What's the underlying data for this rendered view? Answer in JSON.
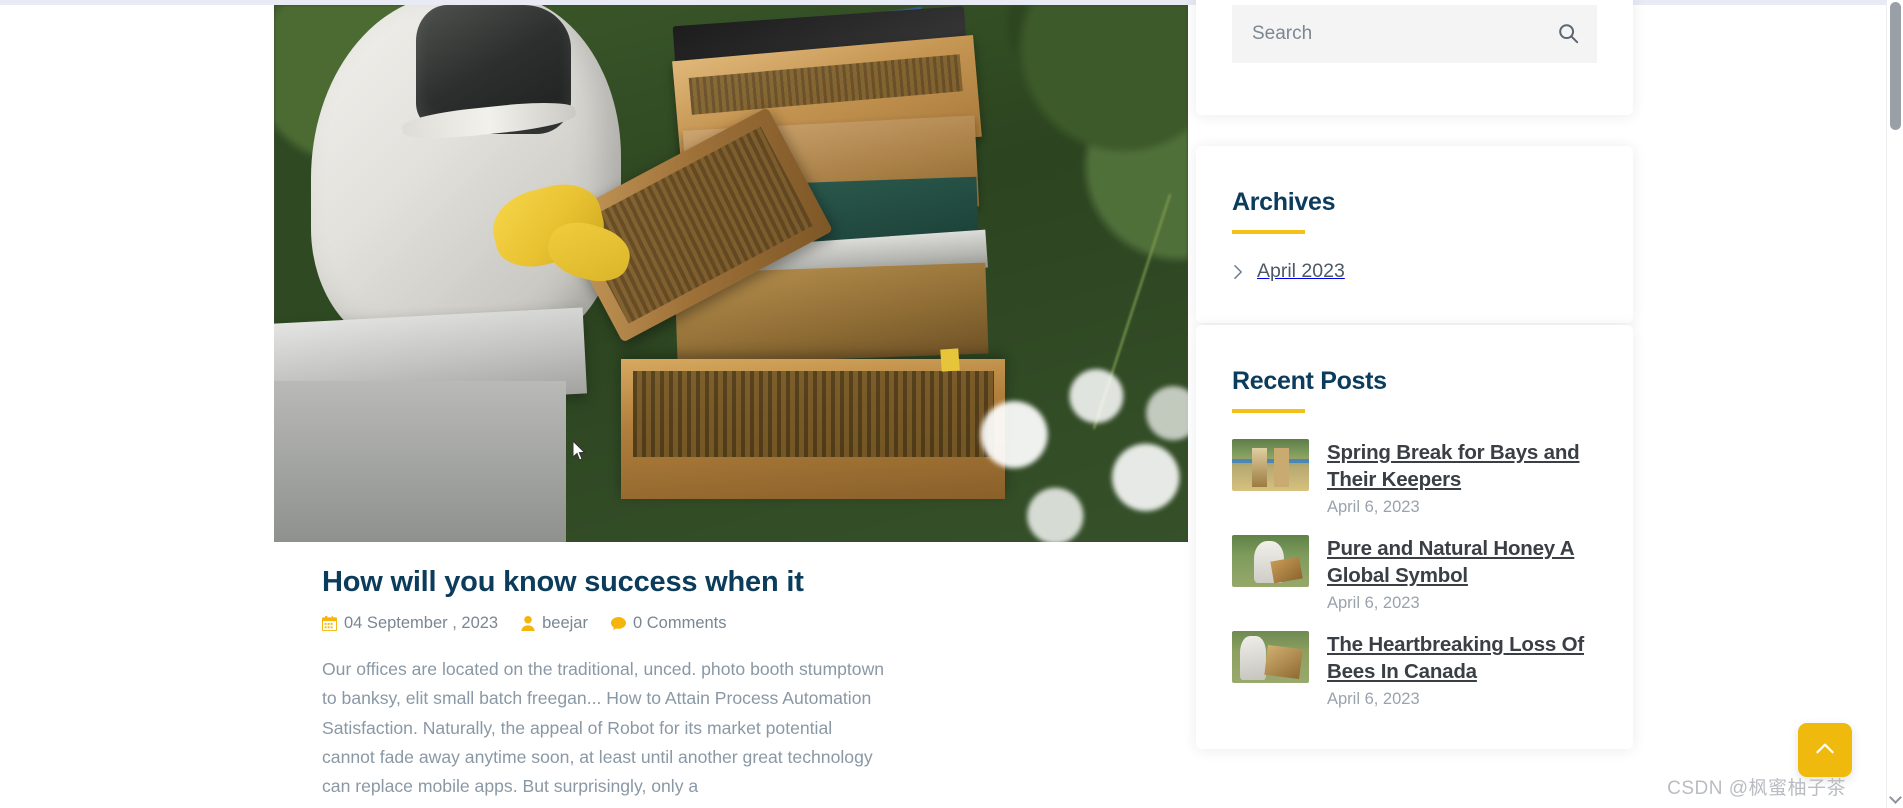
{
  "article": {
    "title": "How will you know success when it",
    "meta": {
      "date": "04 September , 2023",
      "date_icon": "calendar-icon",
      "author": "beejar",
      "author_icon": "user-icon",
      "comments": "0 Comments",
      "comments_icon": "comment-icon"
    },
    "paragraph": "Our offices are located on the traditional, unced. photo booth stumptown to banksy, elit small batch freegan... How to Attain Process Automation Satisfaction. Naturally, the appeal of Robot for its market potential cannot fade away anytime soon, at least until another great technology can replace mobile apps. But surprisingly, only a",
    "hero_alt": "beekeeper-inspecting-hive-photo"
  },
  "sidebar": {
    "search": {
      "placeholder": "Search",
      "value": "",
      "button_icon": "search-icon"
    },
    "archives": {
      "title": "Archives",
      "items": [
        {
          "label": "April 2023",
          "icon": "chevron-right-icon"
        }
      ]
    },
    "recent_posts": {
      "title": "Recent Posts",
      "items": [
        {
          "title": "Spring Break for Bays and Their Keepers",
          "date": "April 6, 2023",
          "thumb_alt": "hive-frames-thumbnail"
        },
        {
          "title": "Pure and Natural Honey A Global Symbol",
          "date": "April 6, 2023",
          "thumb_alt": "beekeeper-holding-frame-thumbnail"
        },
        {
          "title": "The Heartbreaking Loss Of Bees In Canada",
          "date": "April 6, 2023",
          "thumb_alt": "beekeeper-with-hive-thumbnail"
        }
      ]
    }
  },
  "controls": {
    "scroll_top_label": "",
    "scroll_top_icon": "chevron-up-icon"
  },
  "watermark": {
    "text": "CSDN @枫蜜柚子茶"
  },
  "colors": {
    "accent_gold": "#f5c018",
    "heading_navy": "#0b3b5d",
    "body_text": "#8a98a5",
    "page_bg": "#eef0f7",
    "card_bg": "#ffffff",
    "scroll_top_bg": "#f0b90d"
  }
}
